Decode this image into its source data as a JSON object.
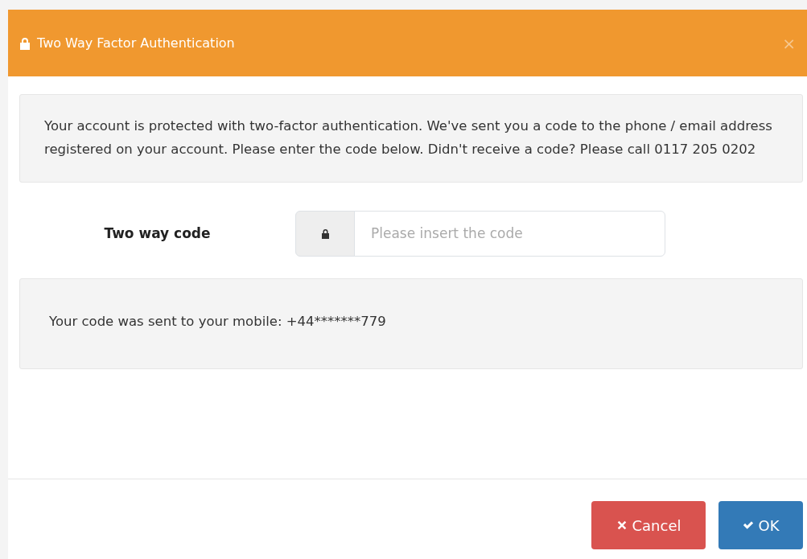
{
  "dialog": {
    "title": "Two Way Factor Authentication",
    "close": "×"
  },
  "notice": "Your account is protected with two-factor authentication. We've sent you a code to the phone / email address registered on your account. Please enter the code below. Didn't receive a code? Please call 0117 205 0202",
  "field": {
    "label": "Two way code",
    "placeholder": "Please insert the code"
  },
  "sent_message": "Your code was sent to your mobile: +44*******779",
  "buttons": [
    {
      "kind": "cancel",
      "label": "Cancel"
    },
    {
      "kind": "ok",
      "label": "OK"
    }
  ]
}
